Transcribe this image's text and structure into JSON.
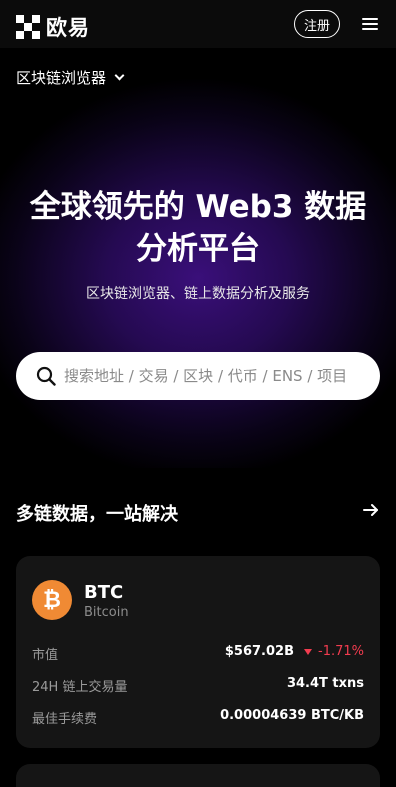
{
  "header": {
    "logo_text": "欧易",
    "register_label": "注册"
  },
  "hero": {
    "chain_selector": "区块链浏览器",
    "title_line1": "全球领先的 Web3 数据",
    "title_line2": "分析平台",
    "subtitle": "区块链浏览器、链上数据分析及服务",
    "search_placeholder": "搜索地址 / 交易 / 区块 / 代币 / ENS / 项目"
  },
  "section": {
    "title": "多链数据，一站解决"
  },
  "card": {
    "coin_glyph": "₿",
    "symbol": "BTC",
    "name": "Bitcoin",
    "rows": [
      {
        "label": "市值",
        "value": "$567.02B",
        "change": "-1.71%"
      },
      {
        "label": "24H 链上交易量",
        "value": "34.4T txns"
      },
      {
        "label": "最佳手续费",
        "value": "0.00004639 BTC/KB"
      }
    ]
  },
  "colors": {
    "accent_negative": "#f23c4f",
    "btc_orange": "#f08a34",
    "hero_purple": "#3a0f7a"
  }
}
